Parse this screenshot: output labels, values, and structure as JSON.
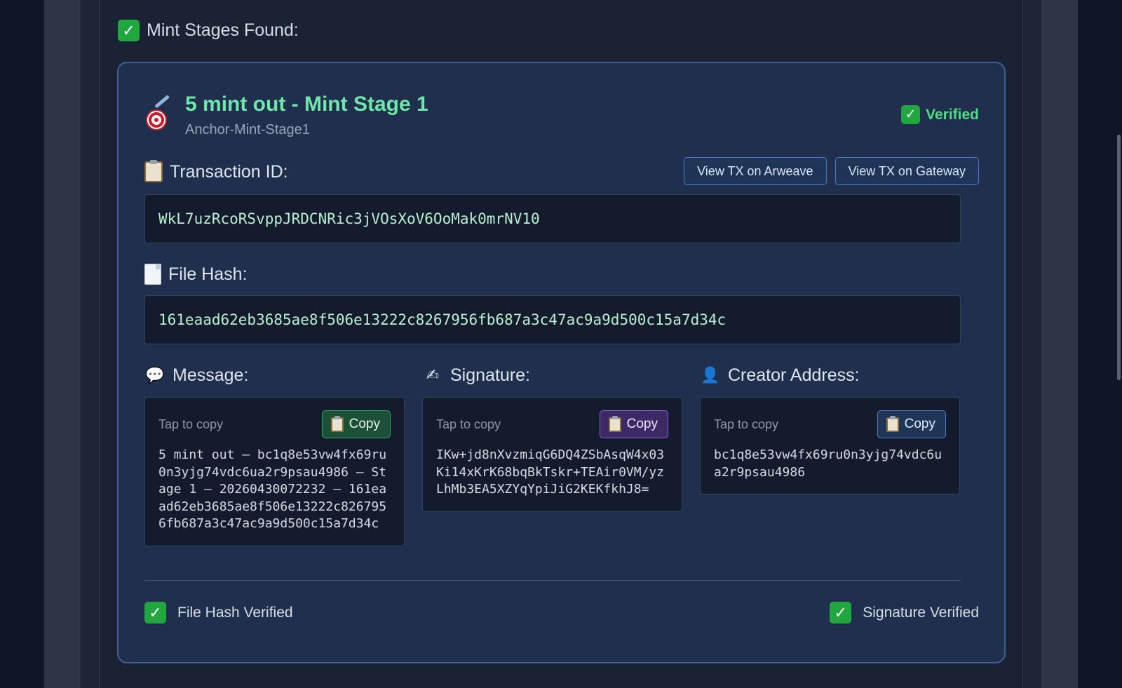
{
  "stages_header": {
    "check_icon": "check-mark-icon",
    "label": "Mint Stages Found:"
  },
  "stage": {
    "icon": "dart-target-icon",
    "title": "5 mint out - Mint Stage 1",
    "subtitle": "Anchor-Mint-Stage1",
    "verified_label": "Verified"
  },
  "transaction": {
    "icon": "clipboard-icon",
    "label": "Transaction ID:",
    "value": "WkL7uzRcoRSvppJRDCNRic3jVOsXoV6OoMak0mrNV10",
    "buttons": {
      "arweave": "View TX on Arweave",
      "gateway": "View TX on Gateway"
    }
  },
  "file_hash": {
    "icon": "document-icon",
    "label": "File Hash:",
    "value": "161eaad62eb3685ae8f506e13222c8267956fb687a3c47ac9a9d500c15a7d34c"
  },
  "message": {
    "icon": "speech-bubble-icon",
    "label": "Message:",
    "hint": "Tap to copy",
    "copy_label": "Copy",
    "value": "5 mint out – bc1q8e53vw4fx69ru0n3yjg74vdc6ua2r9psau4986 – Stage 1 – 20260430072232 – 161eaad62eb3685ae8f506e13222c8267956fb687a3c47ac9a9d500c15a7d34c"
  },
  "signature": {
    "icon": "writing-hand-icon",
    "label": "Signature:",
    "hint": "Tap to copy",
    "copy_label": "Copy",
    "value": "IKw+jd8nXvzmiqG6DQ4ZSbAsqW4x03Ki14xKrK68bqBkTskr+TEAir0VM/yzLhMb3EA5XZYqYpiJiG2KEKfkhJ8="
  },
  "creator": {
    "icon": "person-silhouette-icon",
    "label": "Creator Address:",
    "hint": "Tap to copy",
    "copy_label": "Copy",
    "value": "bc1q8e53vw4fx69ru0n3yjg74vdc6ua2r9psau4986"
  },
  "footer": {
    "file_hash_verified": "File Hash Verified",
    "signature_verified": "Signature Verified"
  },
  "colors": {
    "accent_green": "#6ee7a8",
    "verified_green": "#4ade80",
    "card_border": "#3a6096",
    "card_bg": "#1f2f4d",
    "copy_green": "#2fa36a",
    "copy_purple": "#8a63d6",
    "copy_blue": "#4a7ec4"
  }
}
